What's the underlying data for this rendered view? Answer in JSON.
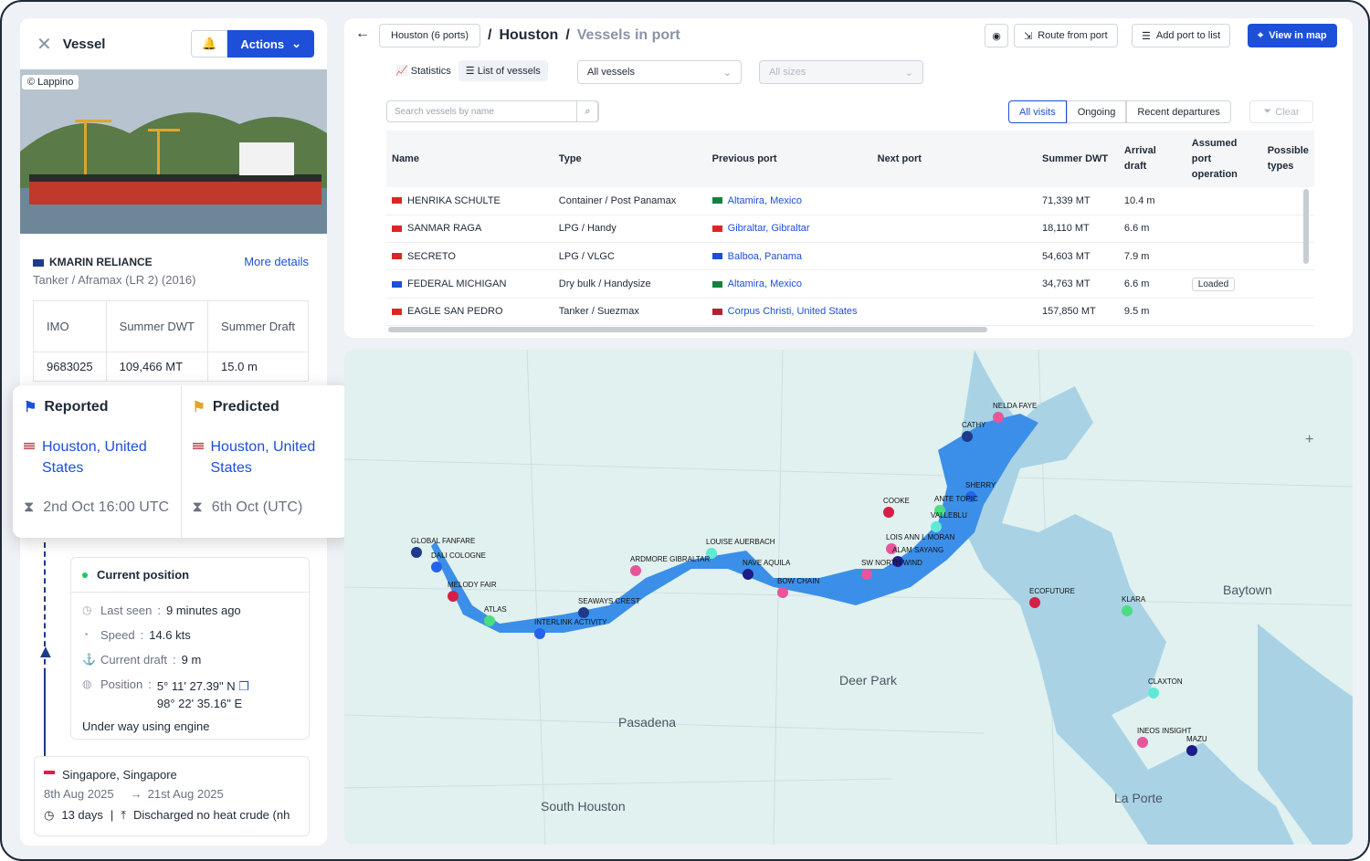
{
  "panel": {
    "title": "Vessel",
    "actions_label": "Actions",
    "photo_credit": "© Lappino",
    "vessel_name": "KMARIN RELIANCE",
    "more_details": "More details",
    "vessel_sub": "Tanker / Aframax (LR 2) (2016)",
    "spec_headers": [
      "IMO",
      "Summer DWT",
      "Summer Draft"
    ],
    "spec_values": [
      "9683025",
      "109,466 MT",
      "15.0 m"
    ]
  },
  "popup": {
    "reported": {
      "title": "Reported",
      "port": "Houston, United States",
      "time": "2nd Oct 16:00 UTC"
    },
    "predicted": {
      "title": "Predicted",
      "port": "Houston, United States",
      "time": "6th Oct (UTC)"
    }
  },
  "position": {
    "title": "Current position",
    "last_seen_label": "Last seen",
    "last_seen": "9 minutes ago",
    "speed_label": "Speed",
    "speed": "14.6 kts",
    "draft_label": "Current draft",
    "draft": "9 m",
    "position_label": "Position",
    "lat": "5° 11' 27.39\" N",
    "lon": "98° 22' 35.16\" E",
    "status": "Under way using engine"
  },
  "trip": {
    "port": "Singapore, Singapore",
    "from": "8th Aug 2025",
    "to": "21st Aug 2025",
    "duration": "13 days",
    "cargo": "Discharged no heat crude (nh"
  },
  "header": {
    "port_pill": "Houston (6 ports)",
    "crumb_port": "Houston",
    "crumb_page": "Vessels in port",
    "route_btn": "Route from port",
    "add_btn": "Add port to list",
    "view_btn": "View in map"
  },
  "tabs": [
    "Statistics",
    "List of vessels"
  ],
  "select_vessels": "All vessels",
  "select_sizes": "All sizes",
  "search_placeholder": "Search vessels by name",
  "visit_filters": [
    "All visits",
    "Ongoing",
    "Recent departures"
  ],
  "clear": "Clear",
  "table": {
    "headers": [
      "Name",
      "Type",
      "Previous port",
      "Next port",
      "Summer DWT",
      "Arrival draft",
      "Assumed port operation",
      "Possible types"
    ],
    "rows": [
      {
        "name": "HENRIKA SCHULTE",
        "type": "Container / Post Panamax",
        "prev": "Altamira, Mexico",
        "dwt": "71,339 MT",
        "draft": "10.4 m",
        "op": ""
      },
      {
        "name": "SANMAR RAGA",
        "type": "LPG / Handy",
        "prev": "Gibraltar, Gibraltar",
        "dwt": "18,110 MT",
        "draft": "6.6 m",
        "op": ""
      },
      {
        "name": "SECRETO",
        "type": "LPG / VLGC",
        "prev": "Balboa, Panama",
        "dwt": "54,603 MT",
        "draft": "7.9 m",
        "op": ""
      },
      {
        "name": "FEDERAL MICHIGAN",
        "type": "Dry bulk / Handysize",
        "prev": "Altamira, Mexico",
        "dwt": "34,763 MT",
        "draft": "6.6 m",
        "op": "Loaded"
      },
      {
        "name": "EAGLE SAN PEDRO",
        "type": "Tanker / Suezmax",
        "prev": "Corpus Christi, United States",
        "dwt": "157,850 MT",
        "draft": "9.5 m",
        "op": ""
      }
    ]
  },
  "map": {
    "places": [
      "Baytown",
      "Deer Park",
      "Pasadena",
      "South Houston",
      "La Porte"
    ],
    "vessels": [
      "NELDA FAYE",
      "CATHY",
      "SHERRY",
      "COOKE",
      "ANTE TOPIC",
      "VALLEBLU",
      "LOIS ANN L MORAN",
      "ALAM SAYANG",
      "SW NORTH WIND",
      "GLOBAL FANFARE",
      "DALI COLOGNE",
      "MELODY FAIR",
      "ATLAS",
      "LOUISE AUERBACH",
      "ARDMORE GIBRALTAR",
      "NAVE AQUILA",
      "BOW CHAIN",
      "SEAWAYS CREST",
      "INTERLINK ACTIVITY",
      "ECOFUTURE",
      "KLARA",
      "CLAXTON",
      "INEOS INSIGHT",
      "MAZU"
    ]
  }
}
